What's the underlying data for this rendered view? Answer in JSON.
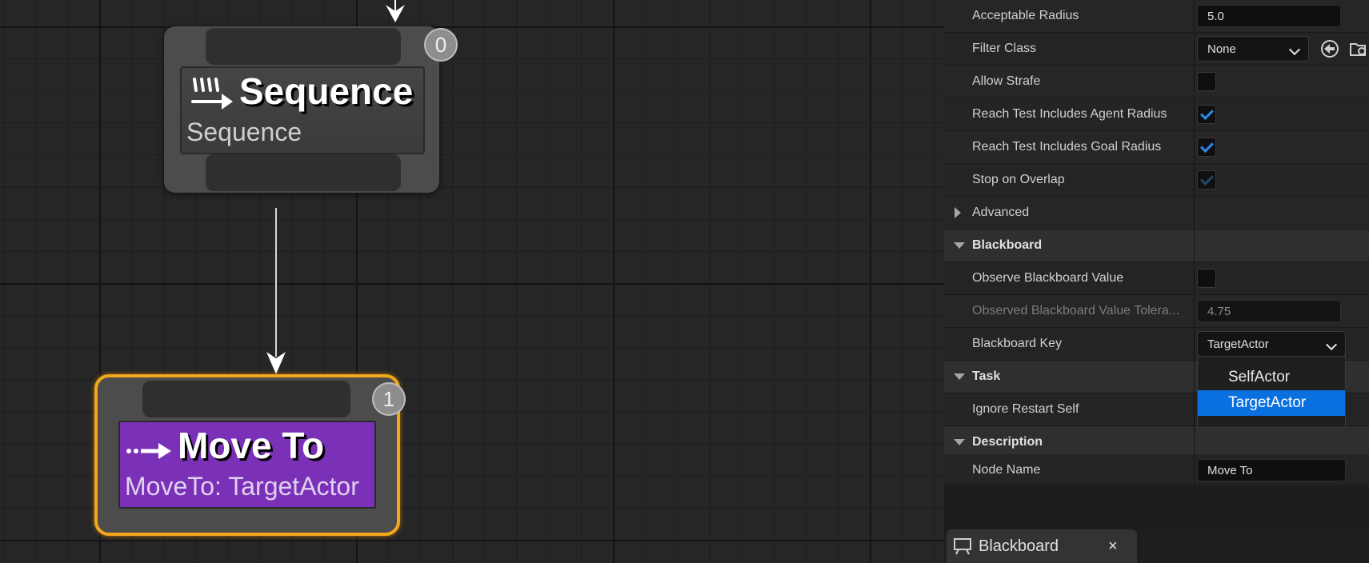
{
  "graph": {
    "sequence_node": {
      "title": "Sequence",
      "subtitle": "Sequence",
      "index": "0",
      "icon": "sequence-icon"
    },
    "moveto_node": {
      "title": "Move To",
      "subtitle": "MoveTo: TargetActor",
      "index": "1",
      "icon": "move-to-icon",
      "accent": "#7a31b8",
      "selection_color": "#f2a81c"
    }
  },
  "details": {
    "acceptable_radius": {
      "label": "Acceptable Radius",
      "value": "5.0"
    },
    "filter_class": {
      "label": "Filter Class",
      "value": "None"
    },
    "allow_strafe": {
      "label": "Allow Strafe",
      "checked": false
    },
    "reach_agent_radius": {
      "label": "Reach Test Includes Agent Radius",
      "checked": true
    },
    "reach_goal_radius": {
      "label": "Reach Test Includes Goal Radius",
      "checked": true
    },
    "stop_on_overlap": {
      "label": "Stop on Overlap",
      "checked": true,
      "enabled": false
    },
    "advanced": {
      "label": "Advanced",
      "expanded": false
    },
    "blackboard_section": {
      "label": "Blackboard",
      "expanded": true
    },
    "observe_bb_value": {
      "label": "Observe Blackboard Value",
      "checked": false
    },
    "observed_tolerance": {
      "label": "Observed Blackboard Value Tolera...",
      "value": "4.75"
    },
    "blackboard_key": {
      "label": "Blackboard Key",
      "value": "TargetActor"
    },
    "task_section": {
      "label": "Task",
      "expanded": true
    },
    "ignore_restart_self": {
      "label": "Ignore Restart Self"
    },
    "description_section": {
      "label": "Description",
      "expanded": true
    },
    "node_name": {
      "label": "Node Name",
      "value": "Move To"
    }
  },
  "dropdown": {
    "options": [
      "SelfActor",
      "TargetActor"
    ],
    "selected": "TargetActor"
  },
  "bottom_tab": {
    "label": "Blackboard",
    "close": "×"
  },
  "colors": {
    "accent_blue": "#0a70e0",
    "check_blue": "#2a8bea"
  }
}
